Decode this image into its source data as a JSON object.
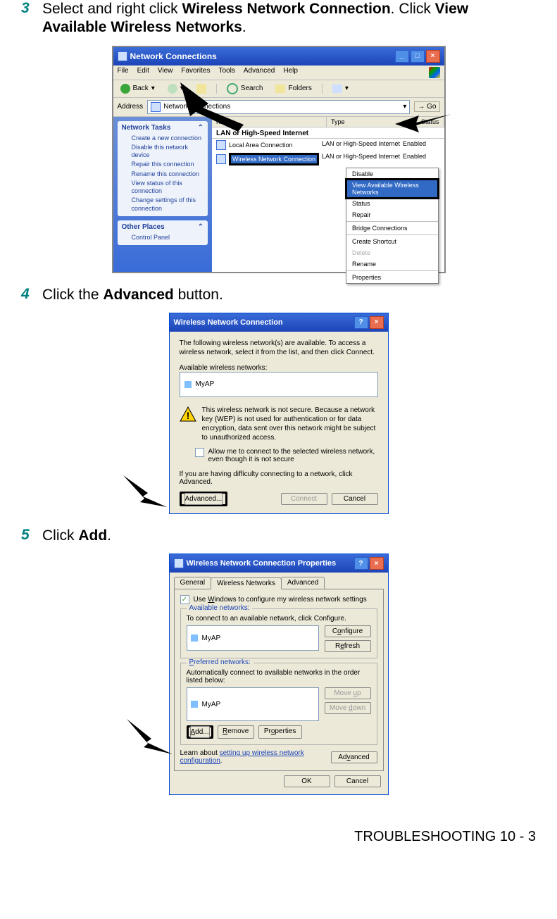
{
  "step3": {
    "num": "3",
    "text_pre": "Select and right click ",
    "bold1": "Wireless Network Connection",
    "mid": ". Click ",
    "bold2": "View Available Wireless Networks",
    "post": "."
  },
  "step4": {
    "num": "4",
    "text_pre": "Click the ",
    "bold1": "Advanced",
    "post": " button."
  },
  "step5": {
    "num": "5",
    "text_pre": "Click ",
    "bold1": "Add",
    "post": "."
  },
  "fig1": {
    "title": "Network Connections",
    "menus": [
      "File",
      "Edit",
      "View",
      "Favorites",
      "Tools",
      "Advanced",
      "Help"
    ],
    "toolbar": {
      "back": "Back",
      "search": "Search",
      "folders": "Folders"
    },
    "address_label": "Address",
    "address_value": "Network Connections",
    "go": "Go",
    "columns": [
      "Name",
      "Type",
      "Status"
    ],
    "group": "LAN or High-Speed Internet",
    "rows": [
      {
        "name": "Local Area Connection",
        "type": "LAN or High-Speed Internet",
        "status": "Enabled"
      },
      {
        "name": "Wireless Network Connection",
        "type": "LAN or High-Speed Internet",
        "status": "Enabled"
      }
    ],
    "context": [
      "Disable",
      "View Available Wireless Networks",
      "Status",
      "Repair",
      "Bridge Connections",
      "Create Shortcut",
      "Delete",
      "Rename",
      "Properties"
    ],
    "task_head": "Network Tasks",
    "tasks": [
      "Create a new connection",
      "Disable this network device",
      "Repair this connection",
      "Rename this connection",
      "View status of this connection",
      "Change settings of this connection"
    ],
    "other_head": "Other Places",
    "other_item": "Control Panel"
  },
  "fig2": {
    "title": "Wireless Network Connection",
    "intro": "The following wireless network(s) are available. To access a wireless network, select it from the list, and then click Connect.",
    "label": "Available wireless networks:",
    "item": "MyAP",
    "warn": "This wireless network is not secure. Because a network key (WEP) is not used for authentication or for data encryption, data sent over this network might be subject to unauthorized access.",
    "chk": "Allow me to connect to the selected wireless network, even though it is not secure",
    "diff": "If you are having difficulty connecting to a network, click Advanced.",
    "advanced": "Advanced...",
    "connect": "Connect",
    "cancel": "Cancel"
  },
  "fig3": {
    "title": "Wireless Network Connection Properties",
    "tabs": [
      "General",
      "Wireless Networks",
      "Advanced"
    ],
    "chk": "Use Windows to configure my wireless network settings",
    "avail_head": "Available networks:",
    "avail_desc": "To connect to an available network, click Configure.",
    "item": "MyAP",
    "configure": "Configure",
    "refresh": "Refresh",
    "pref_head": "Preferred networks:",
    "pref_desc": "Automatically connect to available networks in the order listed below:",
    "moveup": "Move up",
    "movedown": "Move down",
    "add": "Add...",
    "remove": "Remove",
    "properties": "Properties",
    "learn": "Learn about ",
    "learn_link": "setting up wireless network configuration",
    "advanced": "Advanced",
    "ok": "OK",
    "cancel": "Cancel"
  },
  "footer": "TROUBLESHOOTING 10 - 3"
}
